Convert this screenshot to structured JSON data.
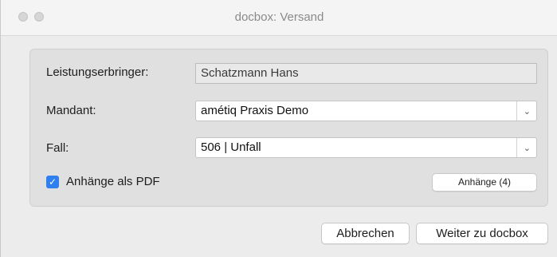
{
  "window": {
    "title": "docbox: Versand"
  },
  "form": {
    "provider_label": "Leistungserbringer:",
    "provider_value": "Schatzmann Hans",
    "client_label": "Mandant:",
    "client_value": "amétiq Praxis Demo",
    "case_label": "Fall:",
    "case_value": "506 | Unfall",
    "attach_pdf_label": "Anhänge als PDF",
    "attach_pdf_checked": true,
    "attachments_button": "Anhänge (4)"
  },
  "actions": {
    "cancel": "Abbrechen",
    "next": "Weiter zu docbox"
  },
  "colors": {
    "accent": "#2f7ff0"
  }
}
